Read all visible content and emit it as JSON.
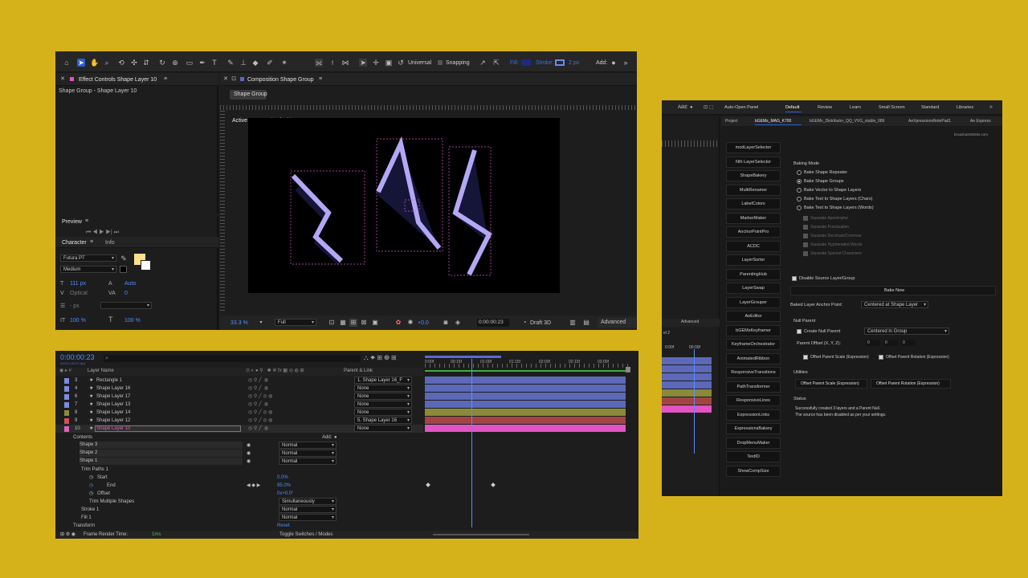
{
  "toolbar": {
    "mode": "Universal",
    "snapping": "Snapping",
    "fill_label": "Fill:",
    "stroke_label": "Stroke:",
    "stroke_width": "2 px",
    "add_label": "Add:"
  },
  "effect_controls": {
    "tab": "Effect Controls Shape Layer 10",
    "subtitle": "Shape Group - Shape Layer 10"
  },
  "preview": {
    "tab": "Preview"
  },
  "character": {
    "tab": "Character",
    "tab2": "Info",
    "font": "Futura PT",
    "style": "Medium",
    "size": "111 px",
    "leading": "Auto",
    "kerning": "Optical",
    "tracking": "0",
    "stroke_px": "- px",
    "v_scale": "100 %",
    "h_scale": "100 %"
  },
  "composition": {
    "tab": "Composition Shape Group",
    "crumb": "Shape Group",
    "camera": "Active Camera (Default)",
    "zoom": "33.3 %",
    "resolution": "Full",
    "exposure": "+0.0",
    "timecode": "0:00:00:23",
    "renderer": "Draft 3D",
    "advanced": "Advanced"
  },
  "timeline": {
    "timecode": "0:00:00:23",
    "fps": "00023 (30.00 fps)",
    "col_layer_name": "Layer Name",
    "col_parent": "Parent & Link",
    "ruler": [
      "0:00f",
      "00:15f",
      "01:00f",
      "01:15f",
      "02:00f",
      "02:15f",
      "03:00f"
    ],
    "layers": [
      {
        "num": "3",
        "name": "Rectangle 1",
        "parent": "1. Shape Layer 16_F",
        "color": "#7a8be0"
      },
      {
        "num": "4",
        "name": "Shape Layer 16",
        "parent": "None",
        "color": "#7a8be0"
      },
      {
        "num": "6",
        "name": "Shape Layer 17",
        "parent": "None",
        "color": "#7a8be0"
      },
      {
        "num": "7",
        "name": "Shape Layer 13",
        "parent": "None",
        "color": "#7a8be0"
      },
      {
        "num": "8",
        "name": "Shape Layer 14",
        "parent": "None",
        "color": "#8a8a3a"
      },
      {
        "num": "9",
        "name": "Shape Layer 12",
        "parent": "5. Shape Layer 16",
        "color": "#d25050"
      },
      {
        "num": "10",
        "name": "Shape Layer 10",
        "parent": "None",
        "color": "#e060c0"
      }
    ],
    "contents_label": "Contents",
    "add_label": "Add:",
    "sublayers": [
      {
        "name": "Shape 3",
        "mode": "Normal"
      },
      {
        "name": "Shape 2",
        "mode": "Normal"
      },
      {
        "name": "Shape 1",
        "mode": "Normal"
      }
    ],
    "trim_label": "Trim Paths 1",
    "start_label": "Start",
    "start_value": "0.0%",
    "end_label": "End",
    "end_value": "95.0%",
    "offset_label": "Offset",
    "offset_value": "0x+0.0°",
    "trim_multiple_label": "Trim Multiple Shapes",
    "trim_multiple_value": "Simultaneously",
    "stroke_label": "Stroke 1",
    "fill_label": "Fill 1",
    "transform_label": "Transform",
    "reset_label": "Reset",
    "stroke_mode": "Normal",
    "fill_mode": "Normal",
    "frame_render": "Frame Render Time:",
    "frame_render_value": "1ms",
    "toggle": "Toggle Switches / Modes"
  },
  "right_window": {
    "add_label": "Add:",
    "autoopen": "Auto-Open Panel",
    "workspaces": [
      "Default",
      "Review",
      "Learn",
      "Small Screen",
      "Standard",
      "Libraries"
    ],
    "tabs": [
      "Project",
      "bGEMs_MAG_K700",
      "bGEMs_Distributor_QQ_VVG_stable_086",
      "AeXpressionsNotePad1",
      "Ae Express"
    ],
    "brand": "broadcastGEMs.com",
    "tools": [
      "modLayerSelector",
      "Nth LayerSelector",
      "ShapeBakery",
      "MultiRenamer",
      "LabelColors",
      "MarkerMaker",
      "AnchorPointPro",
      "ACDC",
      "LayerSorter",
      "ParentingHub",
      "LayerSwap",
      "LayerGrouper",
      "AeEditor",
      "bGEMsKeyframer",
      "KeyframeOrchestrator",
      "AnimatedRibbon",
      "ResponsiveTransitions",
      "PathTransformer",
      "ResponsiveLines",
      "ExpressionLinks",
      "ExpressionsBakery",
      "DropMenuMaker",
      "TextID",
      "ShowCompSize"
    ],
    "baking_mode_label": "Baking Mode",
    "baking_modes": [
      "Bake Shape Repeater",
      "Bake Shape Groups",
      "Bake Vector to Shape Layers",
      "Bake Text to Shape Layers (Chars)",
      "Bake Text to Shape Layers (Words)"
    ],
    "text_options": [
      "Separate Apostrophe",
      "Separate Punctuation",
      "Separate Decimals/Commas",
      "Separate Hyphenated Words",
      "Separate Special Characters"
    ],
    "disable_source": "Disable Source Layer/Group",
    "bake_now": "Bake Now",
    "anchor_label": "Baked Layer Anchor Point:",
    "anchor_value": "Centered at Shape Layer",
    "null_parent_label": "Null Parent",
    "create_null": "Create Null Parent",
    "null_position": "Centered in Group",
    "parent_offset_label": "Parent Offset (X, Y, Z):",
    "parent_offset": [
      "0",
      "0",
      "0"
    ],
    "offset_scale": "Offset Parent Scale (Expression)",
    "offset_rotation": "Offset Parent Rotation (Expression)",
    "utilities_label": "Utilities",
    "status_label": "Status",
    "status_line1": "Successfully created 3 layers and a Parent Null.",
    "status_line2": "The source has been disabled as per your settings.",
    "left_timeline_label": "Advanced",
    "left_layer_label": "el 2",
    "left_ruler": [
      "0:00f",
      "00:00f"
    ]
  },
  "colors": {
    "accent_blue": "#2f5fd0",
    "timeline_blue_bar": "#5c68b8",
    "pink_bar": "#e254c4",
    "olive_bar": "#8a8a3a",
    "red_bar": "#a34444",
    "shape_fill": "#b3a8f5"
  }
}
